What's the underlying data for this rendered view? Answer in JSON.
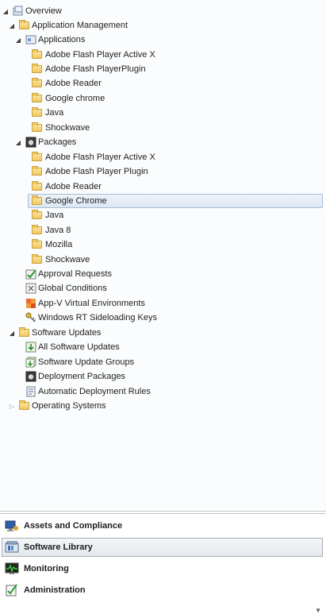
{
  "tree": {
    "overview": "Overview",
    "application_management": "Application Management",
    "applications": {
      "label": "Applications",
      "items": [
        "Adobe Flash Player Active X",
        "Adobe Flash PlayerPlugin",
        "Adobe Reader",
        "Google chrome",
        "Java",
        "Shockwave"
      ]
    },
    "packages": {
      "label": "Packages",
      "items": [
        "Adobe Flash Player Active X",
        "Adobe Flash Player Plugin",
        "Adobe Reader",
        "Google Chrome",
        "Java",
        "Java 8",
        "Mozilla",
        "Shockwave"
      ],
      "selected": "Google Chrome"
    },
    "approval_requests": "Approval Requests",
    "global_conditions": "Global Conditions",
    "appv_environments": "App-V Virtual Environments",
    "sideloading_keys": "Windows RT Sideloading Keys",
    "software_updates": {
      "label": "Software Updates",
      "items": [
        "All Software Updates",
        "Software Update Groups",
        "Deployment Packages",
        "Automatic Deployment Rules"
      ]
    },
    "operating_systems": "Operating Systems"
  },
  "wunderbar": {
    "assets": "Assets and Compliance",
    "library": "Software Library",
    "monitoring": "Monitoring",
    "administration": "Administration",
    "active": "Software Library"
  }
}
